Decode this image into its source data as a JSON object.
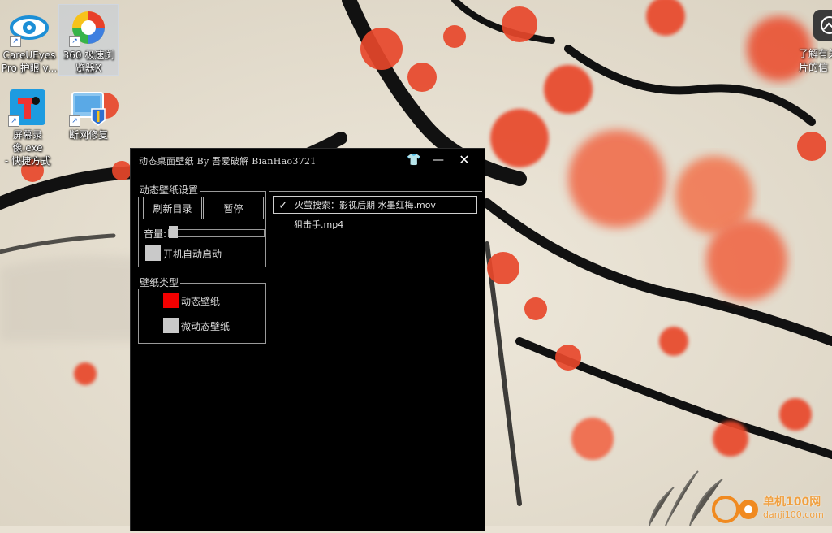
{
  "desktop": {
    "icons": [
      {
        "label": "CareUEyes\nPro 护眼 v...",
        "icon": "eye-icon"
      },
      {
        "label": "360 极速浏\n览器X",
        "icon": "browser-360-icon"
      },
      {
        "label": "屏幕录像.exe\n- 快捷方式",
        "icon": "screen-recorder-icon"
      },
      {
        "label": "断网修复",
        "icon": "network-repair-icon"
      }
    ],
    "edge_text": "了解有关\n片的信"
  },
  "window": {
    "title": "动态桌面壁纸 By 吾爱破解 BianHao3721",
    "buttons": {
      "skin": "👕",
      "minimize": "—",
      "close": "✕"
    }
  },
  "settings": {
    "group_title": "动态壁纸设置",
    "refresh_label": "刷新目录",
    "pause_label": "暂停",
    "volume_label": "音量:",
    "volume_level": 0.0,
    "autostart_label": "开机自动启动",
    "autostart_checked": false
  },
  "wallpaper_type": {
    "group_title": "壁纸类型",
    "options": [
      {
        "label": "动态壁纸",
        "selected": true
      },
      {
        "label": "微动态壁纸",
        "selected": false
      }
    ]
  },
  "file_list": {
    "items": [
      {
        "label": "火萤搜索：影视后期  水墨红梅.mov",
        "selected": true,
        "check": "✓"
      },
      {
        "label": "狙击手.mp4",
        "selected": false,
        "check": ""
      }
    ]
  },
  "watermark": {
    "line1": "单机100网",
    "line2": "danji100.com"
  },
  "colors": {
    "selected_type": "#f20000",
    "unselected": "#c9c9c9",
    "window_bg": "#000000"
  }
}
